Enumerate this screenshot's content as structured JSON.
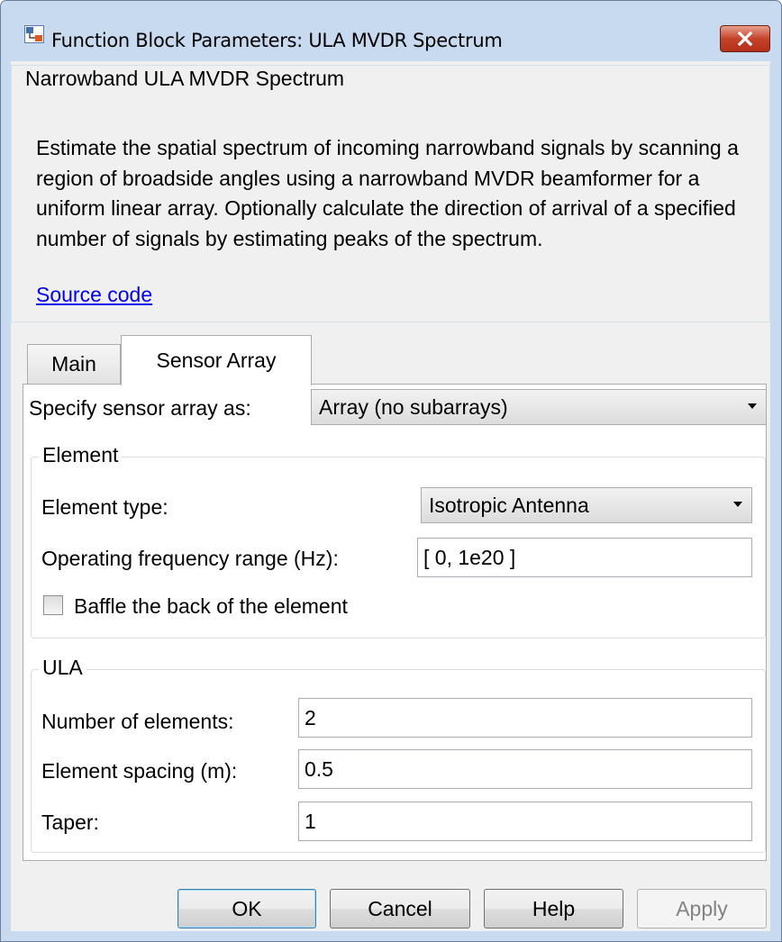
{
  "window": {
    "title": "Function Block Parameters: ULA MVDR Spectrum",
    "icon": "simulink-block-icon",
    "close_icon": "close-icon"
  },
  "description": {
    "group_title": "Narrowband ULA MVDR Spectrum",
    "text": "Estimate the spatial spectrum of incoming narrowband signals by scanning a region of broadside angles using a narrowband MVDR beamformer for a uniform linear array. Optionally calculate the direction of arrival of a specified number of signals by estimating peaks of the spectrum.",
    "source_link": "Source code"
  },
  "tabs": [
    {
      "label": "Main",
      "selected": false
    },
    {
      "label": "Sensor Array",
      "selected": true
    }
  ],
  "sensor_array": {
    "specify_label": "Specify sensor array as:",
    "specify_value": "Array (no subarrays)",
    "element_group": {
      "title": "Element",
      "type_label": "Element type:",
      "type_value": "Isotropic Antenna",
      "freq_label": "Operating frequency range (Hz):",
      "freq_value": "[ 0, 1e20 ]",
      "baffle_label": "Baffle the back of the element",
      "baffle_checked": false
    },
    "ula_group": {
      "title": "ULA",
      "num_label": "Number of elements:",
      "num_value": "2",
      "spacing_label": "Element spacing (m):",
      "spacing_value": "0.5",
      "taper_label": "Taper:",
      "taper_value": "1"
    }
  },
  "buttons": {
    "ok": "OK",
    "cancel": "Cancel",
    "help": "Help",
    "apply": "Apply"
  },
  "colors": {
    "frame": "#c7daf0",
    "link": "#0000ee",
    "close_button": "#c4432a"
  }
}
